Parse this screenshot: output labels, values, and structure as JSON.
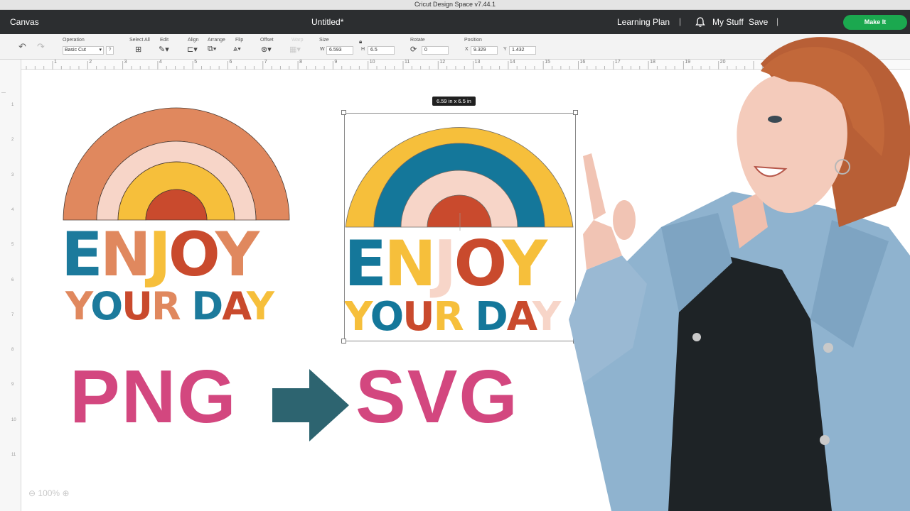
{
  "app": {
    "window_title": "Cricut Design Space  v7.44.1",
    "canvas_label": "Canvas",
    "document_title": "Untitled*",
    "learning_plan": "Learning Plan",
    "my_stuff": "My Stuff",
    "save": "Save",
    "make_it": "Make It"
  },
  "toolbar": {
    "operation_label": "Operation",
    "operation_value": "Basic Cut",
    "select_all_label": "Select All",
    "edit_label": "Edit",
    "align_label": "Align",
    "arrange_label": "Arrange",
    "flip_label": "Flip",
    "offset_label": "Offset",
    "warp_label": "Warp",
    "size_label": "Size",
    "w_label": "W",
    "w_value": "6.593",
    "h_label": "H",
    "h_value": "6.5",
    "rotate_label": "Rotate",
    "rotate_value": "0",
    "position_label": "Position",
    "x_label": "X",
    "x_value": "9.329",
    "y_label": "Y",
    "y_value": "1.432"
  },
  "ruler": {
    "marks": [
      "1",
      "2",
      "3",
      "4",
      "5",
      "6",
      "7",
      "8",
      "9",
      "10",
      "11",
      "12",
      "13",
      "14",
      "15",
      "16",
      "17",
      "18",
      "19",
      "20"
    ],
    "left_marks": [
      "1",
      "2",
      "3",
      "4",
      "5",
      "6",
      "7",
      "8",
      "9",
      "10",
      "11"
    ]
  },
  "canvas": {
    "size_tag": "6.59  in x 6.5  in",
    "zoom": "100%"
  },
  "design_left": {
    "line1": [
      "E",
      "N",
      "J",
      "O",
      "Y"
    ],
    "line2": [
      "Y",
      "O",
      "U",
      "R",
      " ",
      "D",
      "A",
      "Y"
    ]
  },
  "design_right": {
    "line1": [
      "E",
      "N",
      "J",
      "O",
      "Y"
    ],
    "line2": [
      "Y",
      "O",
      "U",
      "R",
      " ",
      "D",
      "A",
      "Y"
    ]
  },
  "headline": {
    "from": "PNG",
    "to": "SVG"
  },
  "colors": {
    "pink": "#d3477f",
    "arrow": "#2d6470",
    "make_it_green": "#1ba84f",
    "rainbow_left": [
      "#e0885e",
      "#f7d5c8",
      "#f6bf3b",
      "#c94a2d"
    ],
    "rainbow_right": [
      "#f6bf3b",
      "#14779a",
      "#f7d5c8",
      "#c94a2d"
    ]
  },
  "icons": [
    "undo-icon",
    "redo-icon",
    "bell-icon",
    "select-all-icon",
    "edit-icon",
    "align-icon",
    "arrange-icon",
    "flip-icon",
    "offset-icon",
    "lock-icon",
    "rotate-icon",
    "zoom-out-icon",
    "zoom-in-icon",
    "arrow-right-icon"
  ]
}
